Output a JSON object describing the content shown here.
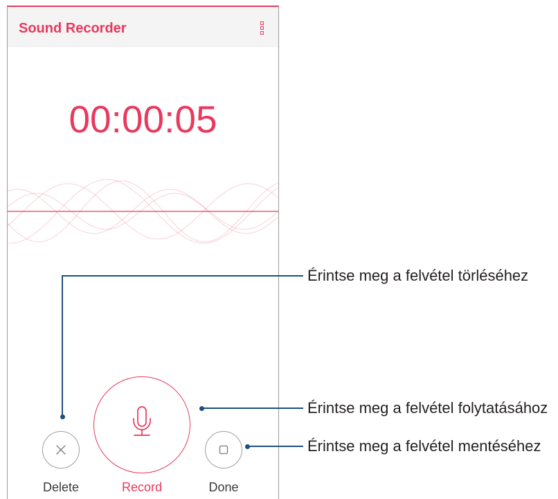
{
  "theme": {
    "accent": "#e8395e",
    "callout_line": "#1c4e80"
  },
  "app_bar": {
    "title": "Sound Recorder",
    "menu_icon": "more-vertical-icon"
  },
  "recorder": {
    "elapsed_time": "00:00:05"
  },
  "controls": {
    "delete": {
      "label": "Delete",
      "icon": "close-icon"
    },
    "record": {
      "label": "Record",
      "icon": "microphone-icon"
    },
    "done": {
      "label": "Done",
      "icon": "stop-square-icon"
    }
  },
  "callouts": {
    "delete": "Érintse meg a felvétel törléséhez",
    "record": "Érintse meg a felvétel folytatásához",
    "done": "Érintse meg a felvétel mentéséhez"
  }
}
